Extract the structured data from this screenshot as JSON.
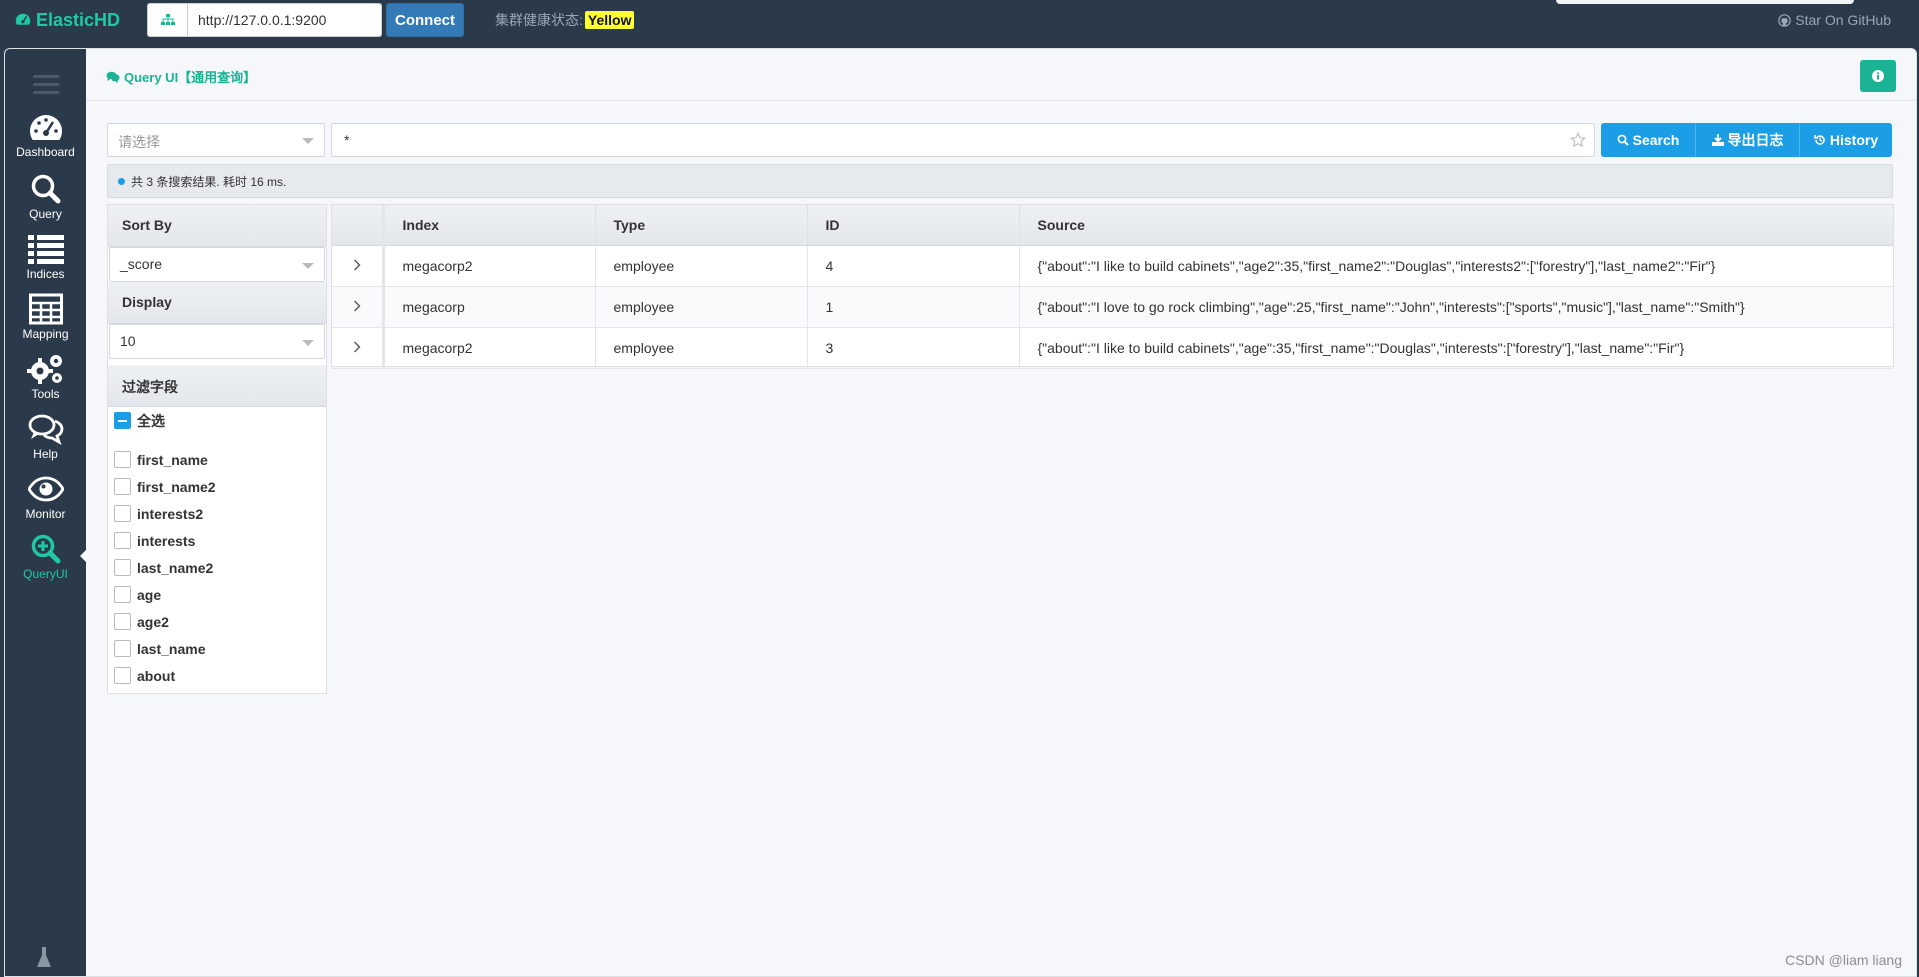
{
  "app": {
    "brand": "ElasticHD",
    "url_value": "http://127.0.0.1:9200",
    "connect_label": "Connect",
    "health_label": "集群健康状态:",
    "health_status": "Yellow",
    "github_label": "Star On GitHub"
  },
  "sidebar": {
    "items": [
      {
        "label": "Dashboard",
        "icon": "dashboard-icon"
      },
      {
        "label": "Query",
        "icon": "search-icon"
      },
      {
        "label": "Indices",
        "icon": "list-icon"
      },
      {
        "label": "Mapping",
        "icon": "table-icon"
      },
      {
        "label": "Tools",
        "icon": "gears-icon"
      },
      {
        "label": "Help",
        "icon": "comments-icon"
      },
      {
        "label": "Monitor",
        "icon": "eye-icon"
      },
      {
        "label": "QueryUI",
        "icon": "search-plus-icon",
        "active": true
      }
    ]
  },
  "page": {
    "title": "Query UI【通用查询】"
  },
  "search": {
    "index_placeholder": "请选择",
    "query_value": "*",
    "search_label": "Search",
    "export_label": "导出日志",
    "history_label": "History"
  },
  "result": {
    "summary": "共 3 条搜索结果. 耗时 16 ms."
  },
  "filter": {
    "sort_by_label": "Sort By",
    "sort_by_value": "_score",
    "display_label": "Display",
    "display_value": "10",
    "fields_label": "过滤字段",
    "select_all_label": "全选",
    "fields": [
      "first_name",
      "first_name2",
      "interests2",
      "interests",
      "last_name2",
      "age",
      "age2",
      "last_name",
      "about"
    ]
  },
  "table": {
    "headers": [
      "Index",
      "Type",
      "ID",
      "Source"
    ],
    "rows": [
      [
        "megacorp2",
        "employee",
        "4",
        "{\"about\":\"I like to build cabinets\",\"age2\":35,\"first_name2\":\"Douglas\",\"interests2\":[\"forestry\"],\"last_name2\":\"Fir\"}"
      ],
      [
        "megacorp",
        "employee",
        "1",
        "{\"about\":\"I love to go rock climbing\",\"age\":25,\"first_name\":\"John\",\"interests\":[\"sports\",\"music\"],\"last_name\":\"Smith\"}"
      ],
      [
        "megacorp2",
        "employee",
        "3",
        "{\"about\":\"I like to build cabinets\",\"age\":35,\"first_name\":\"Douglas\",\"interests\":[\"forestry\"],\"last_name\":\"Fir\"}"
      ]
    ]
  },
  "watermark": "CSDN @liam liang",
  "colors": {
    "nav_bg": "#2b3a4a",
    "accent_green": "#1ab394",
    "primary_blue": "#1c9ee6",
    "connect_blue": "#337ab7",
    "health_yellow": "#ffff33"
  }
}
